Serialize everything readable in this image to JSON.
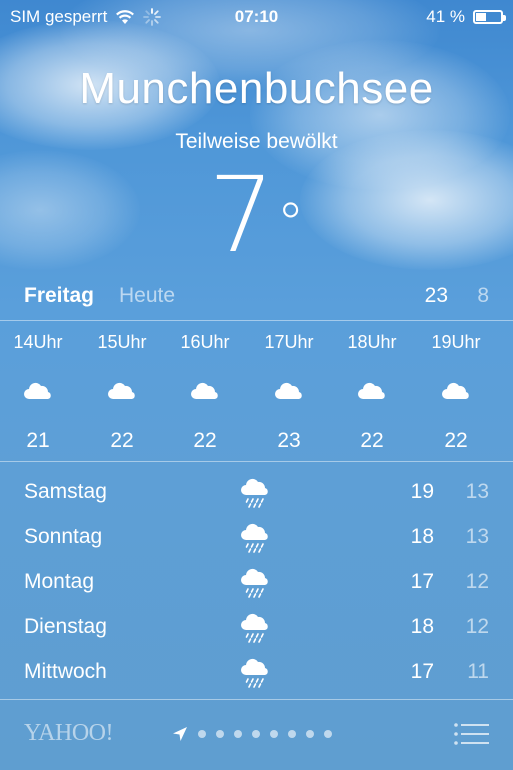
{
  "status_bar": {
    "carrier": "SIM gesperrt",
    "time": "07:10",
    "battery_percent": "41 %",
    "battery_level": 0.41
  },
  "location": {
    "city": "Munchenbuchsee",
    "condition": "Teilweise bewölkt",
    "temperature": "7",
    "degree_symbol": "°"
  },
  "today": {
    "day": "Freitag",
    "label": "Heute",
    "high": "23",
    "low": "8"
  },
  "hourly": [
    {
      "time": "14Uhr",
      "icon": "cloud-icon",
      "temp": "21"
    },
    {
      "time": "15Uhr",
      "icon": "cloud-icon",
      "temp": "22"
    },
    {
      "time": "16Uhr",
      "icon": "cloud-icon",
      "temp": "22"
    },
    {
      "time": "17Uhr",
      "icon": "cloud-icon",
      "temp": "23"
    },
    {
      "time": "18Uhr",
      "icon": "cloud-icon",
      "temp": "22"
    },
    {
      "time": "19Uhr",
      "icon": "cloud-icon",
      "temp": "22"
    }
  ],
  "daily": [
    {
      "day": "Samstag",
      "icon": "rain-cloud-icon",
      "high": "19",
      "low": "13"
    },
    {
      "day": "Sonntag",
      "icon": "rain-cloud-icon",
      "high": "18",
      "low": "13"
    },
    {
      "day": "Montag",
      "icon": "rain-cloud-icon",
      "high": "17",
      "low": "12"
    },
    {
      "day": "Dienstag",
      "icon": "rain-cloud-icon",
      "high": "18",
      "low": "12"
    },
    {
      "day": "Mittwoch",
      "icon": "rain-cloud-icon",
      "high": "17",
      "low": "11"
    }
  ],
  "footer": {
    "brand": "YAHOO!",
    "page_dot_count": 8,
    "menu_icon": "list-icon",
    "location_icon": "location-arrow-icon"
  },
  "colors": {
    "sky_top": "#3f88d0",
    "sky_bottom": "#5f9ed0",
    "text": "#ffffff",
    "muted_text": "rgba(255,255,255,0.6)"
  }
}
